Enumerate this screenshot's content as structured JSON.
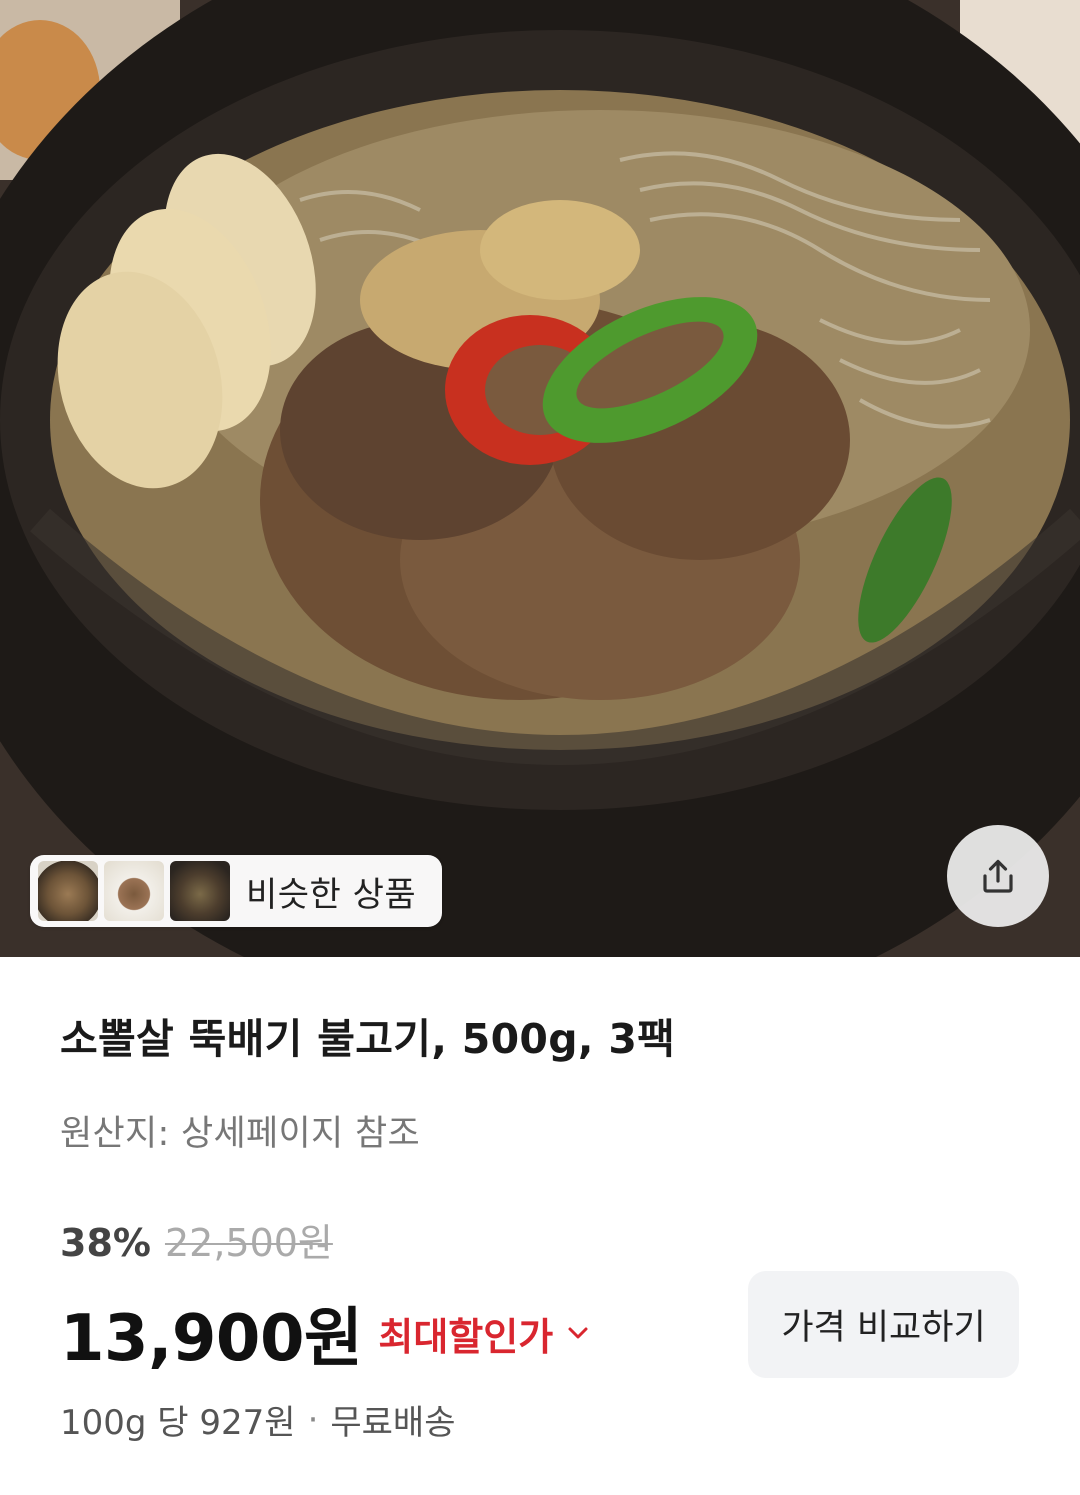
{
  "similar": {
    "label": "비슷한 상품",
    "thumbnails": [
      "thumb-1",
      "thumb-2",
      "thumb-3"
    ]
  },
  "share": {
    "icon": "share-icon"
  },
  "product": {
    "title": "소뽈살 뚝배기 불고기, 500g, 3팩",
    "origin": "원산지: 상세페이지 참조"
  },
  "pricing": {
    "discount": "38%",
    "original_price": "22,500원",
    "price": "13,900원",
    "best_price_label": "최대할인가",
    "compare_button": "가격 비교하기",
    "unit_price": "100g 당 927원",
    "separator": "·",
    "shipping": "무료배송"
  },
  "colors": {
    "accent_red": "#d9262f",
    "compare_bg": "#f2f3f5"
  }
}
